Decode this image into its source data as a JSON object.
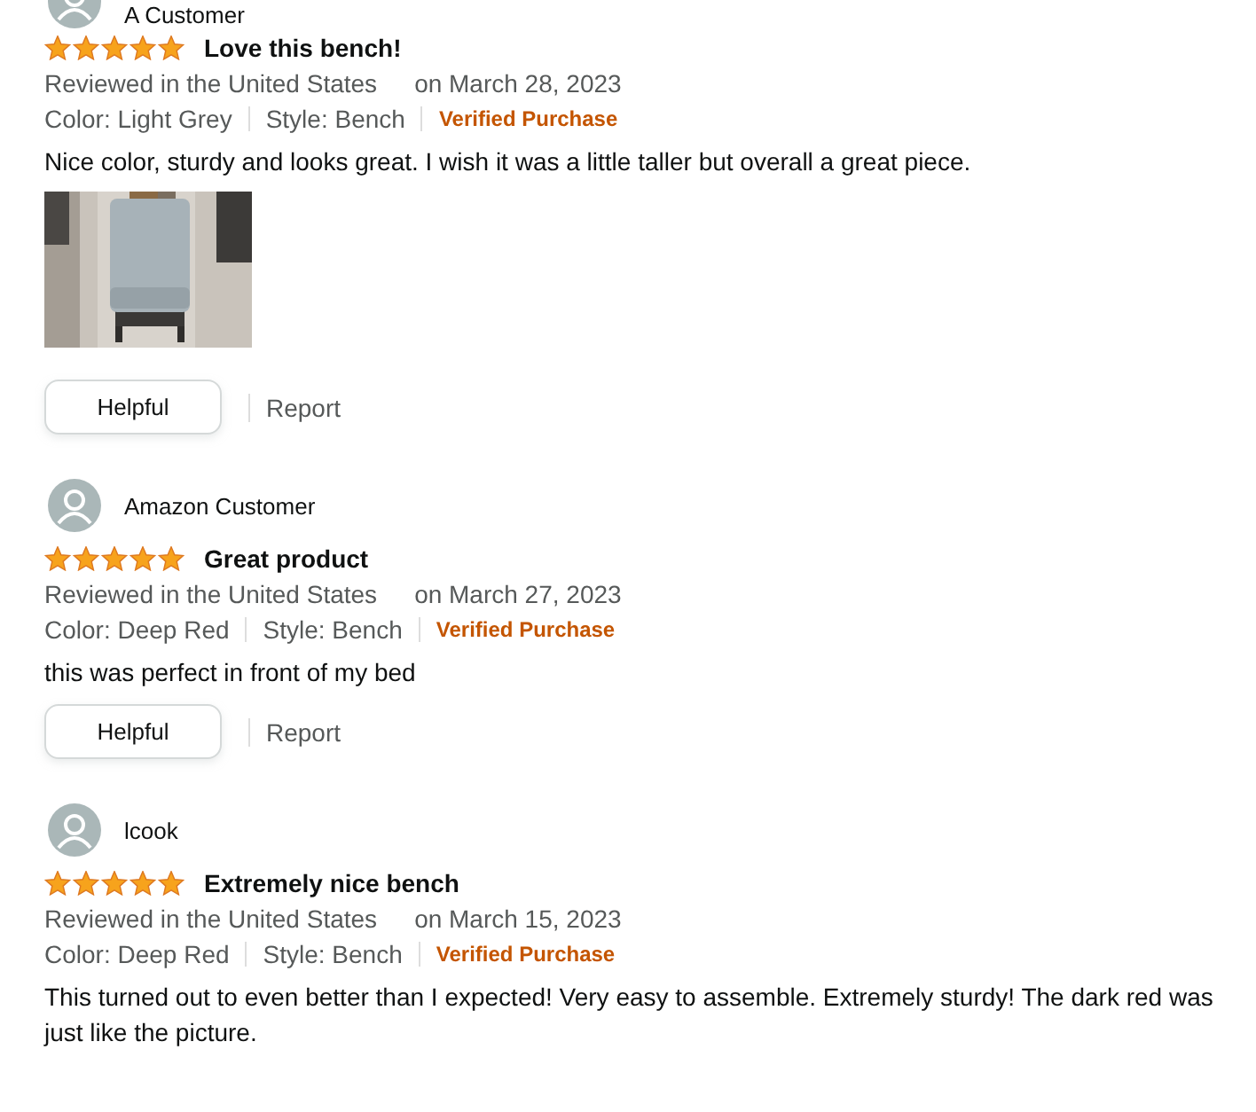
{
  "reviews": [
    {
      "author": "A Customer",
      "stars": 5,
      "title": "Love this bench!",
      "location": "Reviewed in the United States",
      "date": "on March 28, 2023",
      "variant_color": "Color: Light Grey",
      "variant_style": "Style: Bench",
      "badge": "Verified Purchase",
      "body": "Nice color, sturdy and looks great. I wish it was a little taller but overall a great piece.",
      "images": [
        {
          "kind": "picture"
        }
      ],
      "helpful": "Helpful",
      "report": "Report"
    },
    {
      "author": "Amazon Customer",
      "stars": 5,
      "title": "Great product",
      "location": "Reviewed in the United States",
      "date": "on March 27, 2023",
      "variant_color": "Color: Deep Red",
      "variant_style": "Style: Bench",
      "badge": "Verified Purchase",
      "body": "this was perfect in front of my bed",
      "helpful": "Helpful",
      "report": "Report"
    },
    {
      "author": "lcook",
      "stars": 5,
      "title": "Extremely nice bench",
      "location": "Reviewed in the United States",
      "date": "on March 15, 2023",
      "variant_color": "Color: Deep Red",
      "variant_style": "Style: Bench",
      "badge": "Verified Purchase",
      "body": "This turned out to even better than I expected! Very easy to assemble. Extremely sturdy! The dark red was just like the picture."
    }
  ]
}
